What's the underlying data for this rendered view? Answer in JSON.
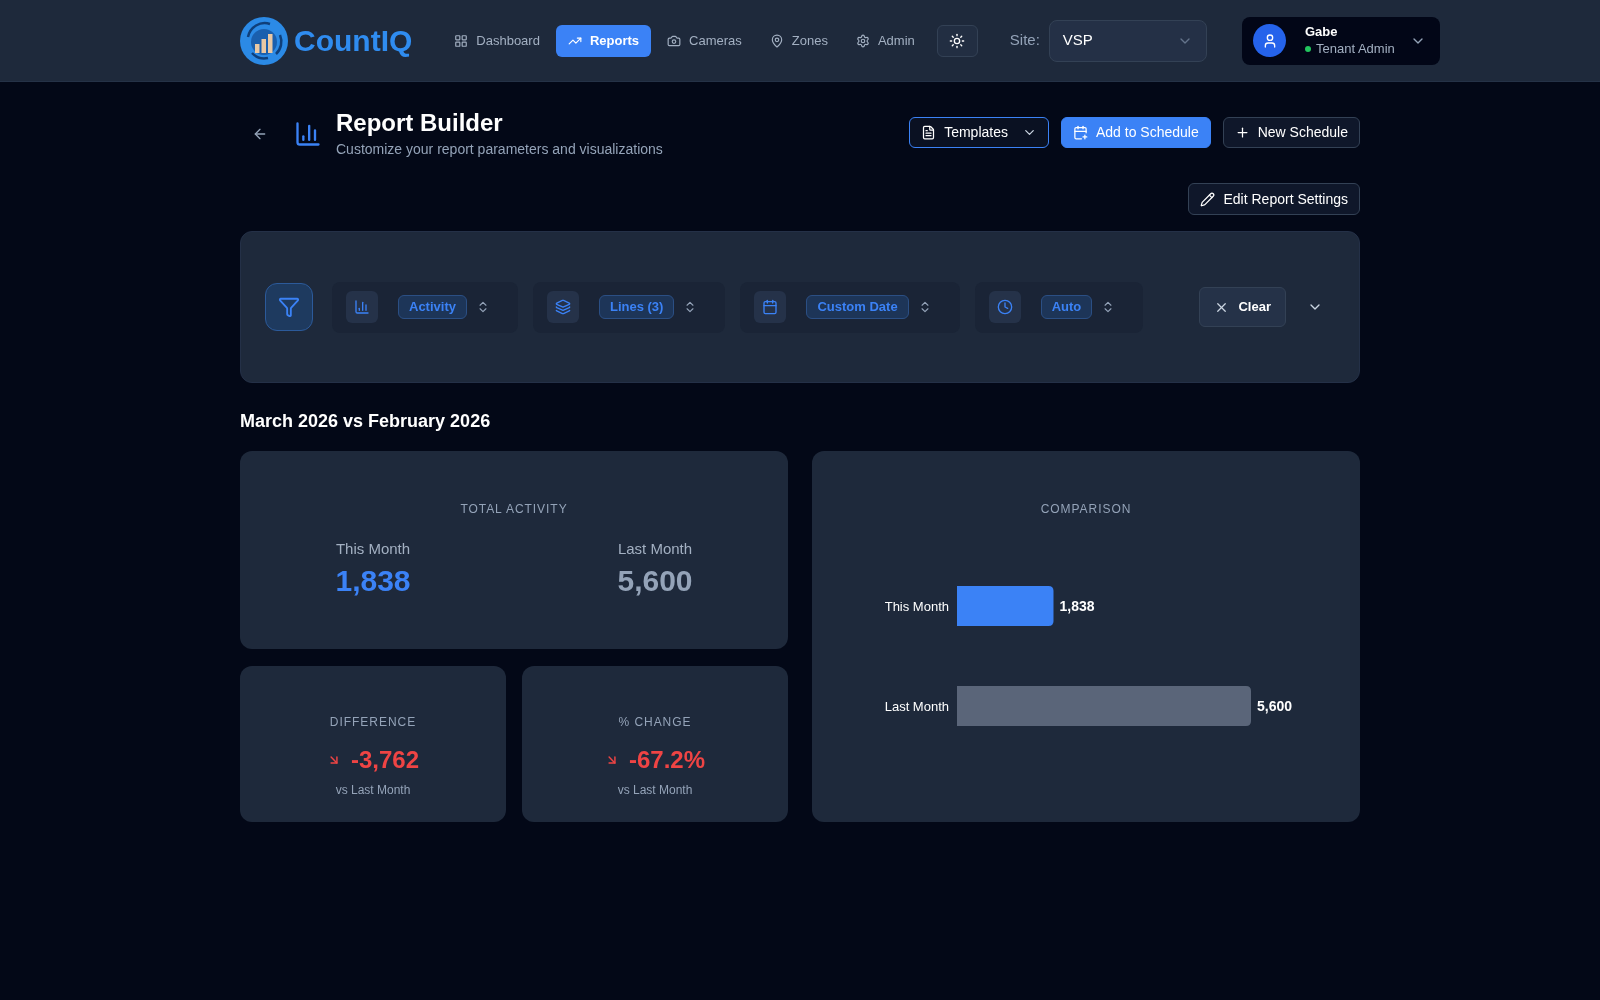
{
  "header": {
    "brand": "CountIQ",
    "nav": [
      {
        "label": "Dashboard",
        "selected": false
      },
      {
        "label": "Reports",
        "selected": true
      },
      {
        "label": "Cameras",
        "selected": false
      },
      {
        "label": "Zones",
        "selected": false
      },
      {
        "label": "Admin",
        "selected": false
      }
    ],
    "site": {
      "label": "Site:",
      "value": "VSP"
    },
    "user": {
      "name": "Gabe",
      "role": "Tenant Admin",
      "online": true
    }
  },
  "page_header": {
    "title": "Report Builder",
    "subtitle": "Customize your report parameters and visualizations",
    "actions": [
      {
        "label": "Templates",
        "kind": "dropdown"
      },
      {
        "label": "Add to Schedule",
        "kind": "primary"
      },
      {
        "label": "New Schedule",
        "kind": "secondary"
      }
    ],
    "settings_button": {
      "label": "Edit Report Settings"
    }
  },
  "filters": {
    "items": [
      {
        "kind": "metric",
        "value": "Activity"
      },
      {
        "kind": "lines",
        "value": "Lines (3)"
      },
      {
        "kind": "date",
        "value": "Custom Date"
      },
      {
        "kind": "interval",
        "value": "Auto"
      }
    ],
    "clear_button": "Clear",
    "expanded": false
  },
  "period_title": "March 2026 vs February 2026",
  "total_card": {
    "label": "TOTAL ACTIVITY",
    "columns": [
      {
        "kind": "current",
        "label": "This Month",
        "value": "1,838"
      },
      {
        "kind": "previous",
        "label": "Last Month",
        "value": "5,600"
      }
    ]
  },
  "stat_cards": [
    {
      "label": "DIFFERENCE",
      "kind": "decrease",
      "value": "-3,762",
      "caption": "vs Last Month"
    },
    {
      "label": "% CHANGE",
      "kind": "decrease",
      "value": "-67.2%",
      "caption": "vs Last Month"
    }
  ],
  "comparison": {
    "chart_data": {
      "type": "bar",
      "orientation": "horizontal",
      "title": "COMPARISON",
      "categories": [
        "This Month",
        "Last Month"
      ],
      "values": [
        1838,
        5600
      ],
      "colors": [
        "#3b82f6",
        "#5a6579"
      ],
      "value_labels": [
        "1,838",
        "5,600"
      ]
    }
  }
}
